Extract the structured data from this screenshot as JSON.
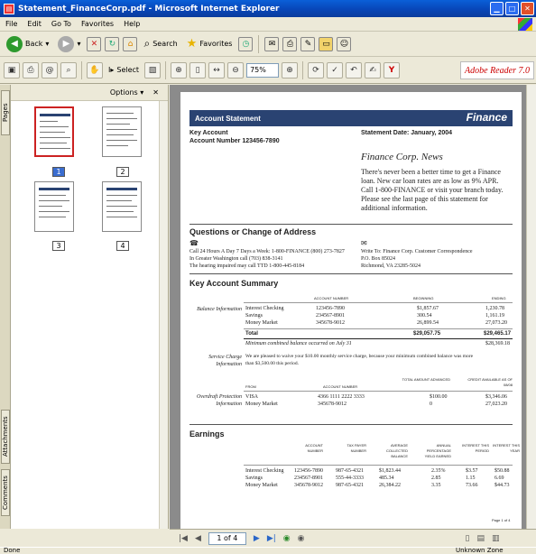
{
  "window": {
    "title": "Statement_FinanceCorp.pdf - Microsoft Internet Explorer"
  },
  "menu": [
    "File",
    "Edit",
    "Go To",
    "Favorites",
    "Help"
  ],
  "toolbar": {
    "back": "Back",
    "search": "Search",
    "favorites": "Favorites",
    "select": "Select",
    "zoom": "75%",
    "adobe": "Adobe Reader 7.0"
  },
  "panel": {
    "options": "Options",
    "close": "✕",
    "tabs": {
      "pages": "Pages",
      "attachments": "Attachments",
      "comments": "Comments"
    },
    "thumbs": [
      "1",
      "2",
      "3",
      "4"
    ]
  },
  "doc": {
    "banner": "Account Statement",
    "logo": "Finance",
    "key_account": "Key Account",
    "account_number": "Account Number 123456-7890",
    "statement_date": "Statement Date: January, 2004",
    "news_title": "Finance Corp. News",
    "news_body": [
      "There's never been a better time to get a Finance",
      "loan. New car loan rates are as low as 9% APR.",
      "Call 1-800-FINANCE or visit your branch today.",
      "Please see the last page of this statement for",
      "additional information."
    ],
    "questions_title": "Questions or Change of Address",
    "phone_lines": [
      "Call 24 Hours A Day 7 Days a Week: 1-800-FINANCE (800) 273-7827",
      "In Greater Washington call (703) 838-3141",
      "The hearing impaired may call TTD 1-800-445-8184"
    ],
    "mail_lines": [
      "Write To: Finance Corp. Customer Correspondence",
      "P.O. Box 85024",
      "Richmond, VA 23285-5024"
    ],
    "summary_title": "Key Account Summary",
    "summary_headers": [
      "ACCOUNT NUMBER",
      "BEGINNING",
      "ENDING"
    ],
    "balance_label": "Balance Information",
    "summary_rows": [
      {
        "name": "Interest Checking",
        "num": "123456-7890",
        "beg": "$1,857.67",
        "end": "1,230.78"
      },
      {
        "name": "Savings",
        "num": "234567-8901",
        "beg": "300.54",
        "end": "1,161.19"
      },
      {
        "name": "Money Market",
        "num": "345678-9012",
        "beg": "26,899.54",
        "end": "27,073.20"
      }
    ],
    "total": {
      "label": "Total",
      "beg": "$29,057.75",
      "end": "$29,465.17"
    },
    "minimum": {
      "label": "Minimum combined balance occurred on July 31",
      "value": "$28,369.18"
    },
    "service_label": "Service Charge Information",
    "service_text": [
      "We are pleased to waive your $10.00 monthly service charge, because your minimum combined balance was more",
      "than $3,500.00 this period."
    ],
    "od_headers": [
      "FROM",
      "ACCOUNT NUMBER",
      "TOTAL AMOUNT ADVANCED",
      "CREDIT AVAILABLE AS OF 08/08"
    ],
    "od_label": "Overdraft Protection Information",
    "od_rows": [
      {
        "from": "VISA",
        "num": "4366 1111 2222 3333",
        "adv": "$100.00",
        "avail": "$3,346.06"
      },
      {
        "from": "Money Market",
        "num": "345678-9012",
        "adv": "0",
        "avail": "27,023.20"
      }
    ],
    "earnings_title": "Earnings",
    "earn_headers": [
      "ACCOUNT NUMBER",
      "TAX PAYER NUMBER",
      "AVERAGE COLLECTED BALANCE",
      "ANNUAL PERCENTAGE YIELD EARNED",
      "INTEREST THIS PERIOD",
      "INTEREST THIS YEAR"
    ],
    "earn_rows": [
      {
        "name": "Interest Checking",
        "num": "123456-7890",
        "tax": "987-65-4321",
        "avg": "$1,823.44",
        "apy": "2.35%",
        "ip": "$3.57",
        "iy": "$50.88"
      },
      {
        "name": "Savings",
        "num": "234567-8901",
        "tax": "555-44-3333",
        "avg": "485.34",
        "apy": "2.85",
        "ip": "1.15",
        "iy": "6.69"
      },
      {
        "name": "Money Market",
        "num": "345678-9012",
        "tax": "987-65-4321",
        "avg": "26,384.22",
        "apy": "3.35",
        "ip": "73.66",
        "iy": "$44.73"
      }
    ],
    "page_footer": "Page 1 of 4"
  },
  "nav": {
    "page": "1 of 4"
  },
  "status": {
    "left": "Done",
    "right": "Unknown Zone"
  }
}
